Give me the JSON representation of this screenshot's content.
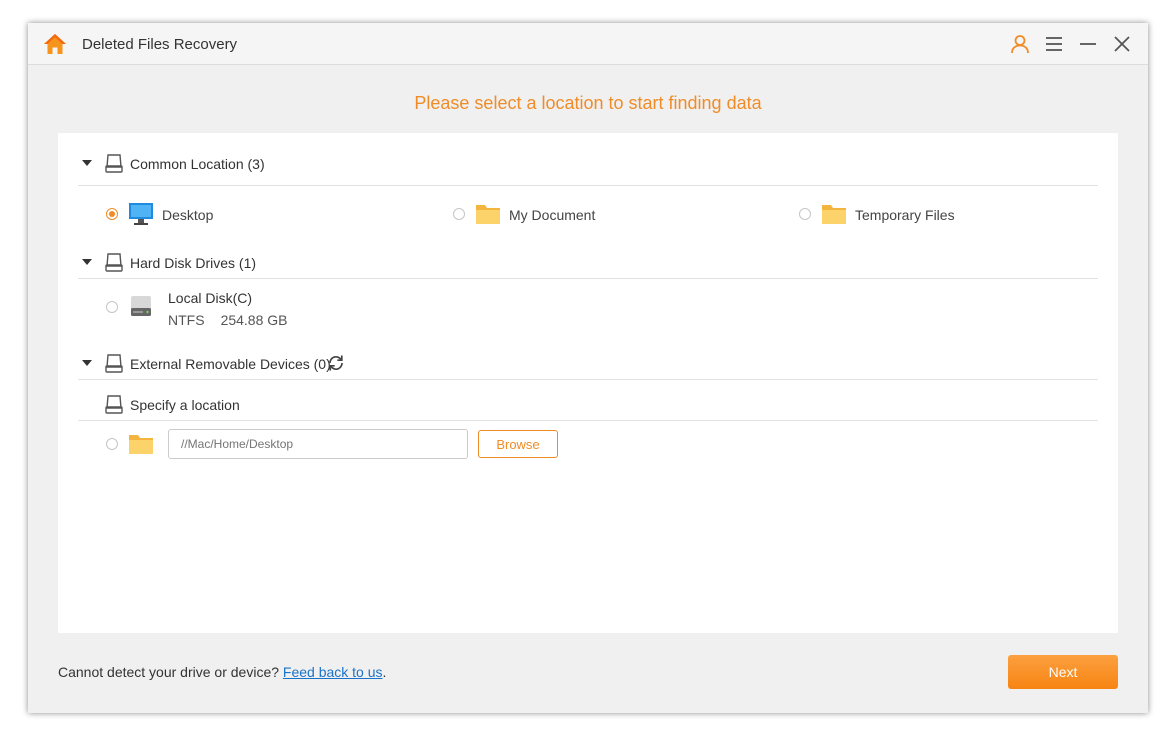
{
  "window": {
    "title": "Deleted Files Recovery",
    "accent_color": "#f08c28",
    "icons": [
      "home-icon",
      "user-icon",
      "menu-icon",
      "minimize-icon",
      "close-icon"
    ]
  },
  "headline": "Please select a location to start finding data",
  "sections": {
    "common": {
      "label": "Common Location (3)",
      "options": [
        {
          "label": "Desktop",
          "icon": "desktop-monitor-icon",
          "selected": true
        },
        {
          "label": "My Document",
          "icon": "folder-icon",
          "selected": false
        },
        {
          "label": "Temporary Files",
          "icon": "folder-icon",
          "selected": false
        }
      ]
    },
    "hard_disk": {
      "label": "Hard Disk Drives (1)",
      "disks": [
        {
          "name": "Local Disk(C)",
          "filesystem": "NTFS",
          "size": "254.88 GB",
          "icon": "hard-drive-icon",
          "selected": false
        }
      ]
    },
    "external": {
      "label": "External Removable Devices (0)",
      "refresh_icon": "refresh-icon"
    },
    "specify": {
      "label": "Specify a location",
      "path_placeholder": "//Mac/Home/Desktop",
      "browse_label": "Browse"
    }
  },
  "footer": {
    "text": "Cannot detect your drive or device?",
    "link": "Feed back to us",
    "trailing": ".",
    "next_label": "Next"
  }
}
